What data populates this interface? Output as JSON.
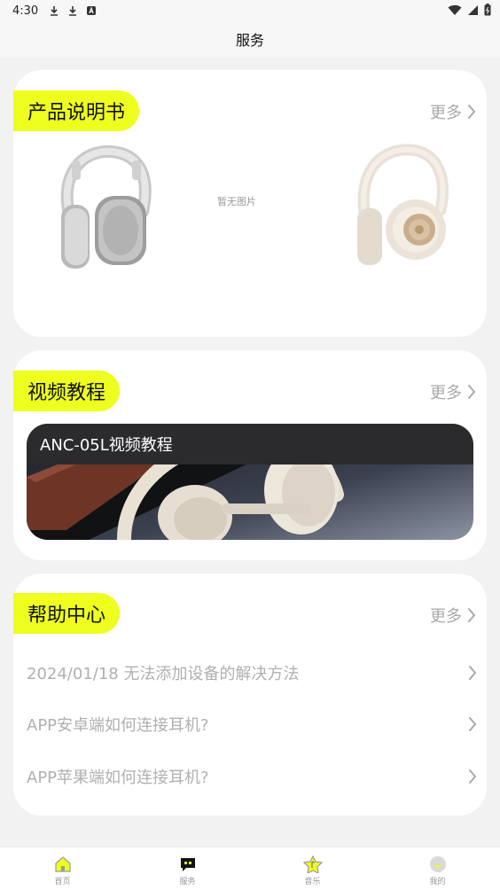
{
  "status_bar": {
    "time": "4:30"
  },
  "nav": {
    "title": "服务"
  },
  "manual": {
    "title": "产品说明书",
    "more": "更多",
    "no_image": "暂无图片"
  },
  "video": {
    "title": "视频教程",
    "more": "更多",
    "item_title": "ANC-05L视频教程"
  },
  "help": {
    "title": "帮助中心",
    "more": "更多",
    "items": [
      {
        "label": "2024/01/18 无法添加设备的解决方法"
      },
      {
        "label": "APP安卓端如何连接耳机?"
      },
      {
        "label": "APP苹果端如何连接耳机?"
      }
    ]
  },
  "tabs": [
    {
      "label": "首页",
      "icon": "home-icon",
      "active": false
    },
    {
      "label": "服务",
      "icon": "service-icon",
      "active": true
    },
    {
      "label": "音乐",
      "icon": "music-icon",
      "active": false
    },
    {
      "label": "我的",
      "icon": "profile-icon",
      "active": false
    }
  ],
  "colors": {
    "accent": "#eeff1f",
    "background": "#f2f2f2",
    "muted_text": "#a9a9a9"
  }
}
